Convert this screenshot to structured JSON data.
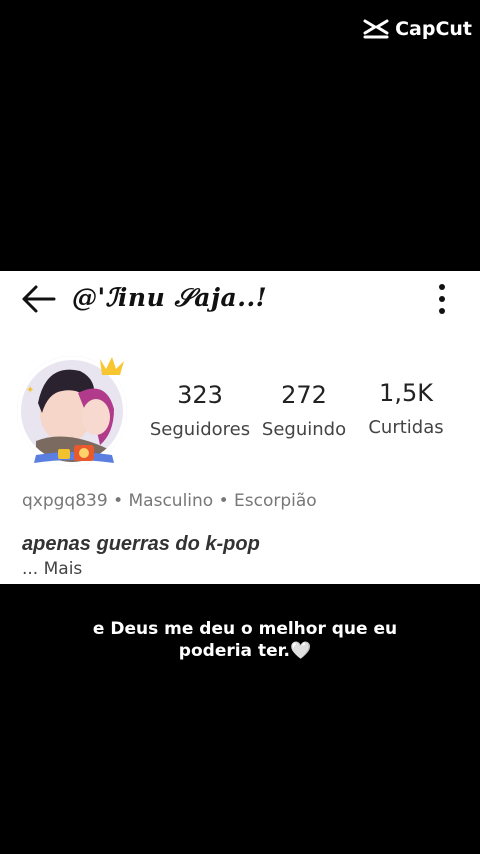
{
  "watermark": {
    "text": "CapCut",
    "icon": "capcut-logo-icon"
  },
  "profile": {
    "username": "@'ℐinu 𝒮aja..!",
    "followers": {
      "value": "323",
      "label": "Seguidores"
    },
    "following": {
      "value": "272",
      "label": "Seguindo"
    },
    "likes": {
      "value": "1,5K",
      "label": "Curtidas"
    },
    "info_line": "qxpgq839 • Masculino • Escorpião",
    "bio": "apenas guerras do k-pop",
    "more_label": "Mais",
    "more_prefix": "..."
  },
  "caption": {
    "line1": "e Deus me deu o melhor que eu",
    "line2": "poderia ter.🤍"
  },
  "colors": {
    "background": "#000000",
    "panel": "#ffffff",
    "text": "#222222"
  }
}
